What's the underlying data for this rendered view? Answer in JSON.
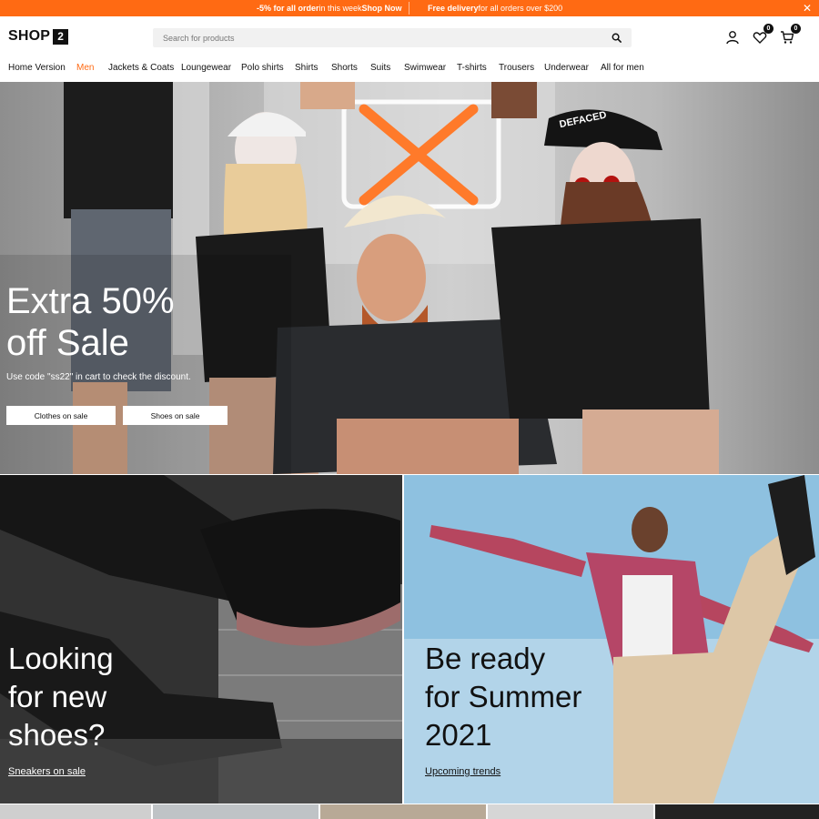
{
  "announcement": {
    "promo_highlight": "-5% for all order",
    "promo_rest": " in this week ",
    "promo_link": "Shop Now",
    "delivery_highlight": "Free delivery",
    "delivery_rest": " for all orders over $200",
    "close": "✕"
  },
  "header": {
    "logo_text": "SHOP",
    "logo_badge": "2",
    "search_placeholder": "Search for products",
    "wishlist_count": "0",
    "cart_count": "0"
  },
  "nav": {
    "items": [
      {
        "label": "Home Version",
        "active": false
      },
      {
        "label": "Men",
        "active": true
      },
      {
        "label": "Jackets & Coats",
        "active": false
      },
      {
        "label": "Loungewear",
        "active": false
      },
      {
        "label": "Polo shirts",
        "active": false
      },
      {
        "label": "Shirts",
        "active": false
      },
      {
        "label": "Shorts",
        "active": false
      },
      {
        "label": "Suits",
        "active": false
      },
      {
        "label": "Swimwear",
        "active": false
      },
      {
        "label": "T-shirts",
        "active": false
      },
      {
        "label": "Trousers",
        "active": false
      },
      {
        "label": "Underwear",
        "active": false
      },
      {
        "label": "All for men",
        "active": false
      }
    ]
  },
  "hero": {
    "title": "Extra 50% off Sale",
    "subtitle": "Use code \"ss22\" in cart to check the discount.",
    "button_clothes": "Clothes on sale",
    "button_shoes": "Shoes on sale",
    "cap_text": "DEFACED"
  },
  "banners": {
    "left": {
      "title_line1": "Looking",
      "title_line2": "for new",
      "title_line3": "shoes?",
      "link": "Sneakers on sale"
    },
    "right": {
      "title_line1": "Be ready",
      "title_line2": "for Summer",
      "title_line3": "2021",
      "link": "Upcoming trends"
    }
  },
  "colors": {
    "accent": "#ff6a13",
    "dark": "#111111"
  }
}
